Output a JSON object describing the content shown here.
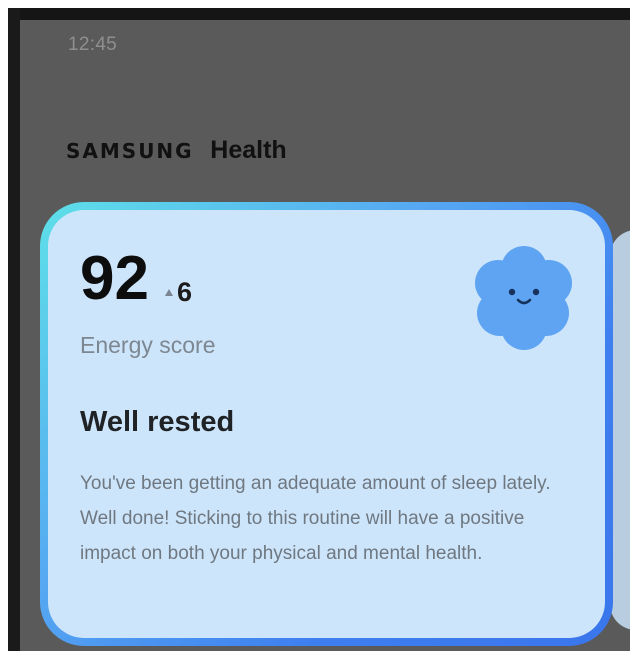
{
  "status_bar": {
    "time": "12:45"
  },
  "app": {
    "brand": "SAMSUNG",
    "name": "Health"
  },
  "energy_card": {
    "score": "92",
    "delta": "6",
    "score_label": "Energy score",
    "status": "Well rested",
    "description": "You've been getting an adequate amount of sleep lately. Well done! Sticking to this routine will have a positive impact on both your physical and mental health.",
    "mood_icon": "smiling-flower-icon"
  },
  "colors": {
    "card_fill": "#cde5fb",
    "card_border_start": "#5ee0e8",
    "card_border_end": "#3a76ec",
    "mood_icon": "#5ea4f2",
    "screen_background": "#5a5a5a"
  }
}
